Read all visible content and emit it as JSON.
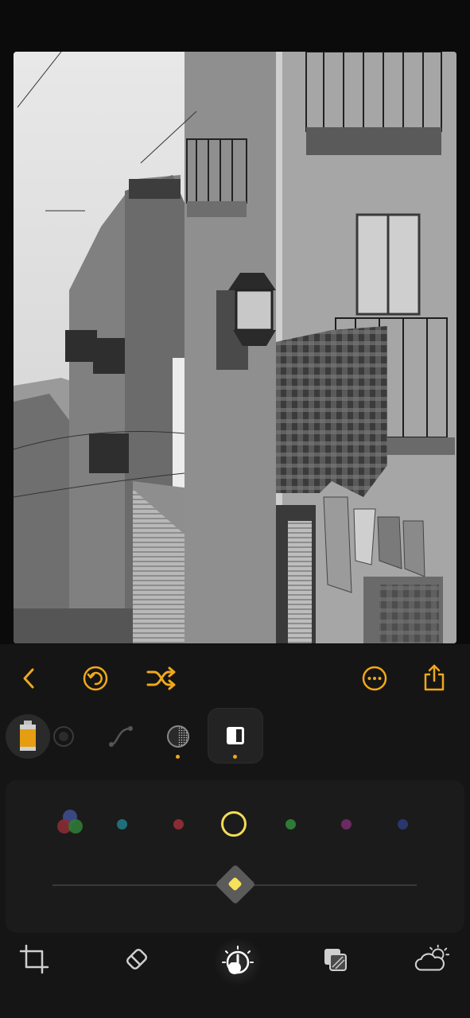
{
  "photo": {
    "subject": "black-and-white-street-photo"
  },
  "toolbar": {
    "back_icon": "chevron-left-icon",
    "revert_icon": "revert-icon",
    "shuffle_icon": "shuffle-icon",
    "more_icon": "more-icon",
    "share_icon": "share-icon"
  },
  "tools": {
    "items": [
      "film-icon",
      "color-wheel-icon",
      "curves-icon",
      "grain-icon",
      "bw-icon"
    ],
    "active": "bw-icon",
    "indicators": [
      "grain-icon",
      "bw-icon"
    ]
  },
  "hsl": {
    "swatches": [
      {
        "name": "all-colors",
        "color": "multi"
      },
      {
        "name": "cyan",
        "color": "#1f6f79"
      },
      {
        "name": "red",
        "color": "#8a2c33"
      },
      {
        "name": "yellow",
        "color": "#f2dc55",
        "selected": true
      },
      {
        "name": "green",
        "color": "#2f7a36"
      },
      {
        "name": "magenta",
        "color": "#6a2a62"
      },
      {
        "name": "blue",
        "color": "#2b356e"
      }
    ],
    "slider": {
      "value": 0.5
    }
  },
  "bottom_bar": {
    "items": [
      "crop-icon",
      "eraser-icon",
      "adjust-icon",
      "layers-icon",
      "weather-icon"
    ],
    "active": "adjust-icon"
  },
  "colors": {
    "accent": "#f0a81a",
    "highlight": "#f2dc55",
    "panel": "#151515"
  }
}
